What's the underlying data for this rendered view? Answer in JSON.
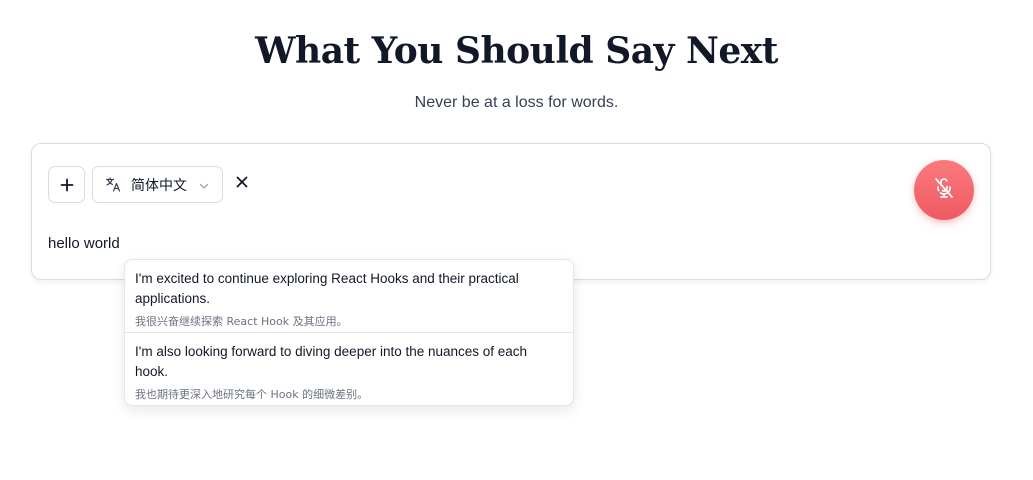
{
  "header": {
    "title": "What You Should Say Next",
    "subtitle": "Never be at a loss for words."
  },
  "toolbar": {
    "add_icon": "plus-icon",
    "language": {
      "icon": "translate-icon",
      "selected": "简体中文",
      "chevron": "chevron-down-icon"
    },
    "clear_icon": "close-icon",
    "mic_icon": "microphone-off-icon",
    "mic_color": "#ef5a62"
  },
  "input": {
    "text": "hello world"
  },
  "suggestions": [
    {
      "en": "I'm excited to continue exploring React Hooks and their practical applications.",
      "zh": "我很兴奋继续探索 React Hook 及其应用。"
    },
    {
      "en": "I'm also looking forward to diving deeper into the nuances of each hook.",
      "zh": "我也期待更深入地研究每个 Hook 的细微差别。"
    }
  ]
}
